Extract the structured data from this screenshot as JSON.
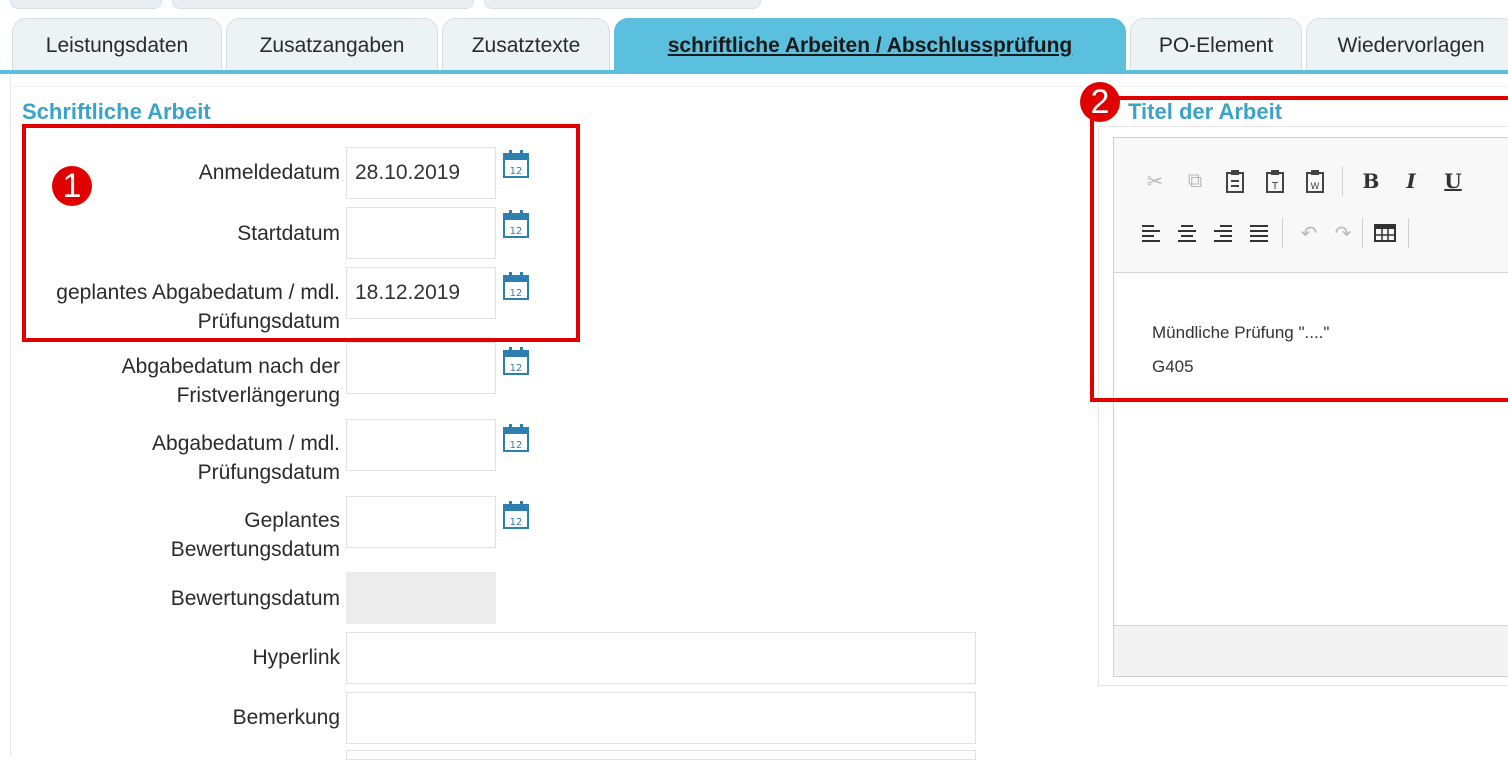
{
  "tabs": [
    {
      "label": "Leistungsdaten",
      "active": false
    },
    {
      "label": "Zusatzangaben",
      "active": false
    },
    {
      "label": "Zusatztexte",
      "active": false
    },
    {
      "label": "schriftliche Arbeiten / Abschlussprüfung",
      "active": true
    },
    {
      "label": "PO-Element",
      "active": false
    },
    {
      "label": "Wiedervorlagen",
      "active": false
    }
  ],
  "left_section": {
    "title": "Schriftliche Arbeit",
    "fields": [
      {
        "label": "Anmeldedatum",
        "value": "28.10.2019",
        "icon": "calendar-icon"
      },
      {
        "label": "Startdatum",
        "value": "",
        "icon": "calendar-icon"
      },
      {
        "label": "geplantes Abgabedatum / mdl. Prüfungsdatum",
        "value": "18.12.2019",
        "icon": "calendar-icon"
      },
      {
        "label": "Abgabedatum nach der Fristverlängerung",
        "value": "",
        "icon": "calendar-icon"
      },
      {
        "label": "Abgabedatum / mdl. Prüfungsdatum",
        "value": "",
        "icon": "calendar-icon"
      },
      {
        "label": "Geplantes Bewertungsdatum",
        "value": "",
        "icon": "calendar-icon"
      },
      {
        "label": "Bewertungsdatum",
        "value": ""
      },
      {
        "label": "Hyperlink",
        "value": ""
      },
      {
        "label": "Bemerkung",
        "value": ""
      }
    ]
  },
  "right_section": {
    "title": "Titel der Arbeit",
    "editor_lines": [
      "Mündliche Prüfung \"....\"",
      "G405"
    ],
    "toolbar_icons": [
      "cut-icon",
      "copy-icon",
      "paste-icon",
      "paste-text-icon",
      "paste-word-icon",
      "bold-icon",
      "italic-icon",
      "underline-icon",
      "align-left-icon",
      "align-center-icon",
      "align-right-icon",
      "justify-icon",
      "undo-icon",
      "redo-icon",
      "table-icon"
    ]
  },
  "annotations": [
    "1",
    "2"
  ],
  "colors": {
    "accent": "#5bc0de",
    "title": "#3aa3c8",
    "annotation": "#e30000"
  }
}
